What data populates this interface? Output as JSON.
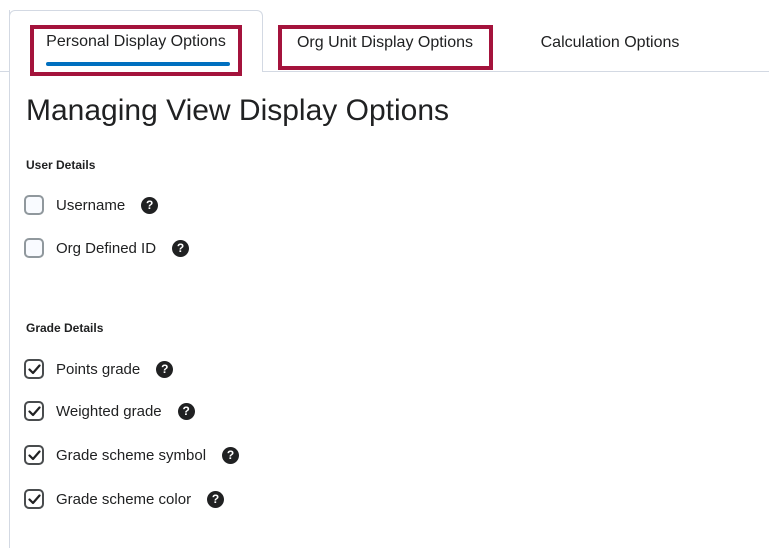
{
  "tabs": [
    {
      "label": "Personal Display Options",
      "active": true
    },
    {
      "label": "Org Unit Display Options",
      "active": false
    },
    {
      "label": "Calculation Options",
      "active": false
    }
  ],
  "page_title": "Managing View Display Options",
  "user_details": {
    "heading": "User Details",
    "items": [
      {
        "label": "Username",
        "checked": false
      },
      {
        "label": "Org Defined ID",
        "checked": false
      }
    ]
  },
  "grade_details": {
    "heading": "Grade Details",
    "items": [
      {
        "label": "Points grade",
        "checked": true
      },
      {
        "label": "Weighted grade",
        "checked": true
      },
      {
        "label": "Grade scheme symbol",
        "checked": true
      },
      {
        "label": "Grade scheme color",
        "checked": true
      }
    ]
  },
  "help_glyph": "?",
  "colors": {
    "highlight": "#a4133c",
    "active_tab_underline": "#006fbf",
    "text": "#202122"
  }
}
